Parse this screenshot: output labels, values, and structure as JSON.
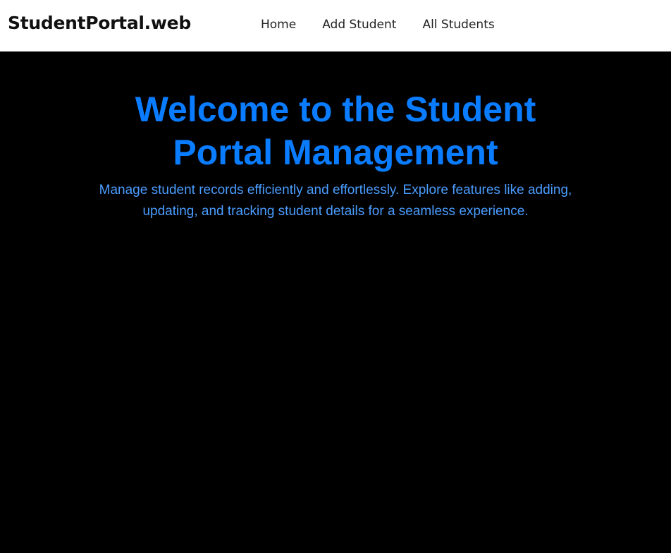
{
  "navbar": {
    "brand": "StudentPortal.web",
    "links": [
      "Home",
      "Add Student",
      "All Students"
    ]
  },
  "hero": {
    "title_lines": [
      "Welcome to the Student",
      "Portal Management"
    ],
    "subtitle_lines": [
      "Manage student records efficiently and effortlessly. Explore features like adding,",
      "updating, and tracking student details for a seamless experience."
    ]
  },
  "colors": {
    "background": "#000000",
    "navbar_background": "#ffffff",
    "title": "#0a7cff",
    "subtitle": "#4a9dff"
  }
}
